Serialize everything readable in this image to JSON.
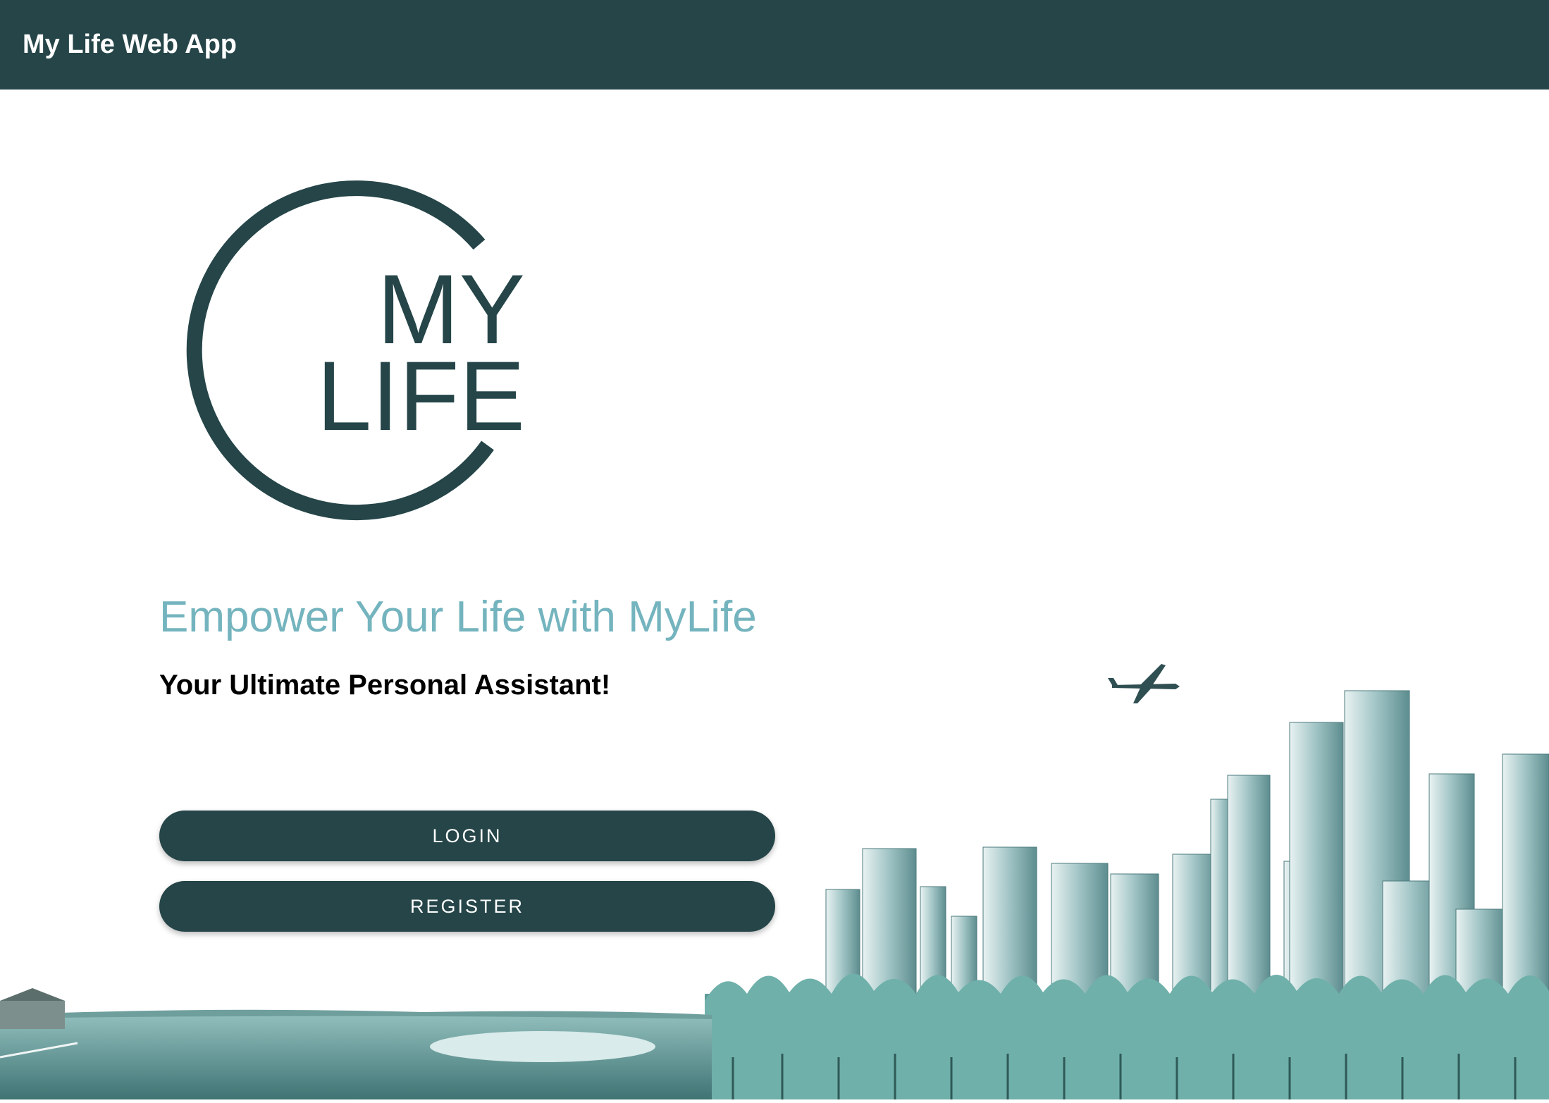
{
  "app_bar": {
    "title": "My Life Web App",
    "background_color": "#254548"
  },
  "logo": {
    "line1": "MY",
    "line2": "LIFE",
    "icon": "mylife-logo-icon"
  },
  "hero": {
    "headline": "Empower Your Life with MyLife",
    "subheadline": "Your Ultimate Personal Assistant!",
    "headline_color": "#74b4be"
  },
  "actions": {
    "login_label": "LOGIN",
    "register_label": "REGISTER"
  },
  "illustration": {
    "icon": "city-landscape-illustration",
    "accent_color": "#5fa3a3"
  }
}
